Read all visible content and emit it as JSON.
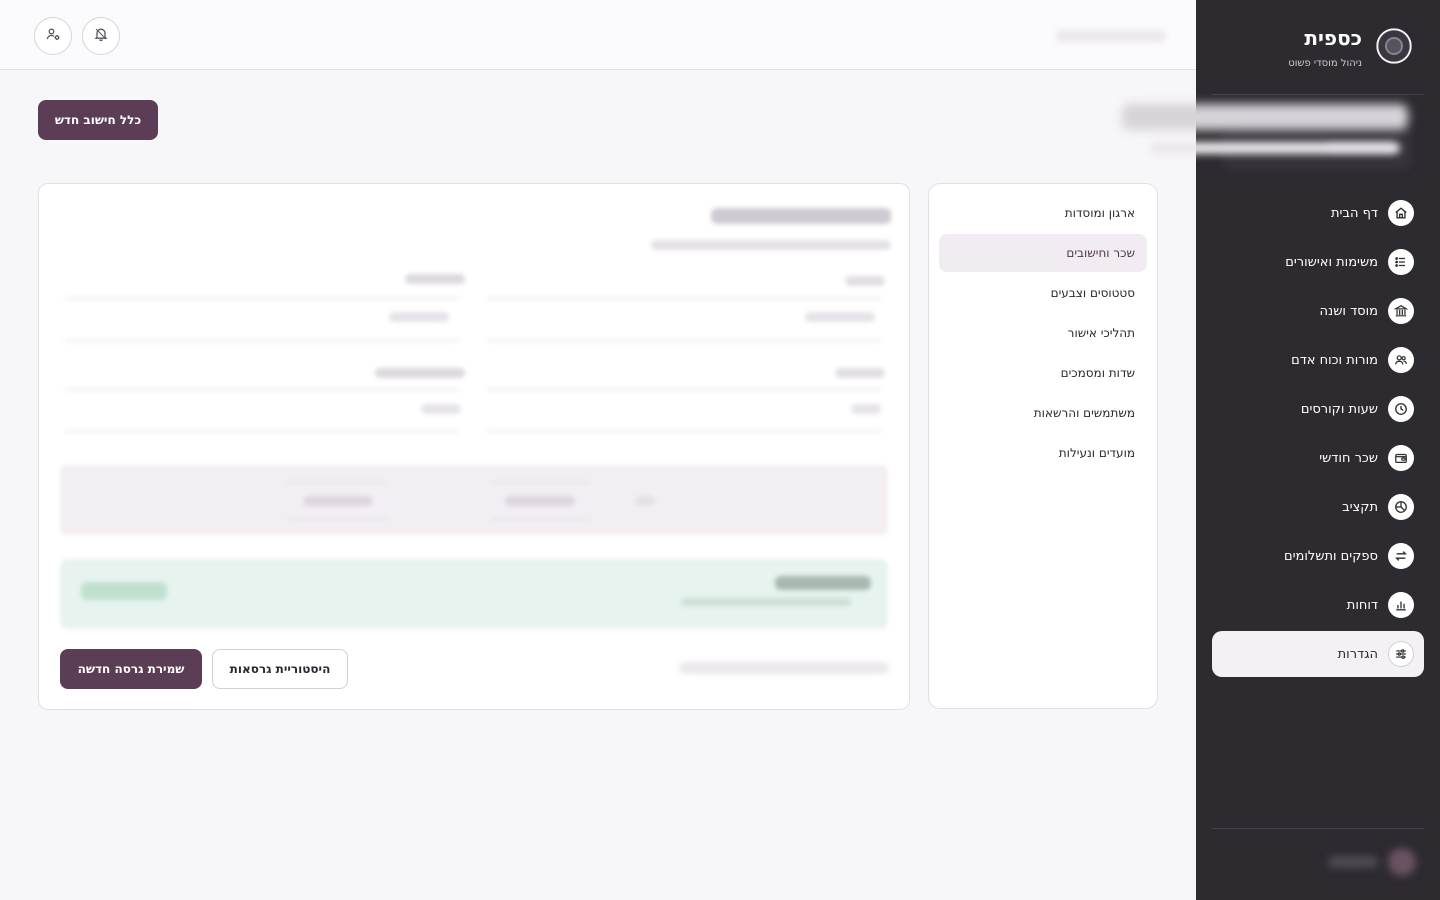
{
  "brand": {
    "title": "כספית",
    "subtitle": "ניהול מוסדי פשוט"
  },
  "sidebar": {
    "items": [
      {
        "label": "דף הבית",
        "icon": "home-icon"
      },
      {
        "label": "משימות ואישורים",
        "icon": "list-icon"
      },
      {
        "label": "מוסד ושנה",
        "icon": "institution-icon"
      },
      {
        "label": "מורות וכוח אדם",
        "icon": "users-icon"
      },
      {
        "label": "שעות וקורסים",
        "icon": "clock-icon"
      },
      {
        "label": "שכר חודשי",
        "icon": "wallet-icon"
      },
      {
        "label": "תקציב",
        "icon": "pie-icon"
      },
      {
        "label": "ספקים ותשלומים",
        "icon": "transfer-icon"
      },
      {
        "label": "דוחות",
        "icon": "bar-chart-icon"
      },
      {
        "label": "הגדרות",
        "icon": "sliders-icon",
        "active": true
      }
    ]
  },
  "header": {
    "new_rule_button": "כלל חישוב חדש"
  },
  "settings_menu": {
    "items": [
      {
        "label": "ארגון ומוסדות"
      },
      {
        "label": "שכר וחישובים",
        "active": true
      },
      {
        "label": "סטטוסים וצבעים"
      },
      {
        "label": "תהליכי אישור"
      },
      {
        "label": "שדות ומסמכים"
      },
      {
        "label": "משתמשים והרשאות"
      },
      {
        "label": "מועדים ונעילות"
      }
    ]
  },
  "actions": {
    "save_version": "שמירת גרסה חדשה",
    "version_history": "היסטוריית גרסאות"
  }
}
